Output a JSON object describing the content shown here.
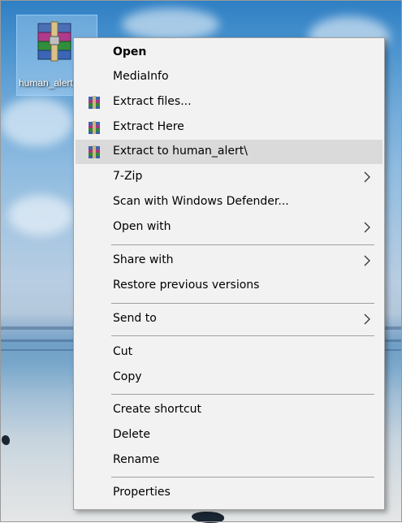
{
  "desktop_icon": {
    "label": "human_alert",
    "icon": "winrar-archive-icon"
  },
  "context_menu": {
    "highlighted_item": "Extract to human_alert\\",
    "items": [
      {
        "label": "Open",
        "bold": true
      },
      {
        "label": "MediaInfo"
      },
      {
        "label": "Extract files...",
        "icon": "winrar-icon"
      },
      {
        "label": "Extract Here",
        "icon": "winrar-icon"
      },
      {
        "label": "Extract to human_alert\\",
        "icon": "winrar-icon"
      },
      {
        "label": "7-Zip",
        "submenu": true
      },
      {
        "label": "Scan with Windows Defender..."
      },
      {
        "label": "Open with",
        "submenu": true
      },
      {
        "label": "Share with",
        "submenu": true
      },
      {
        "label": "Restore previous versions"
      },
      {
        "label": "Send to",
        "submenu": true
      },
      {
        "label": "Cut"
      },
      {
        "label": "Copy"
      },
      {
        "label": "Create shortcut"
      },
      {
        "label": "Delete"
      },
      {
        "label": "Rename"
      },
      {
        "label": "Properties"
      }
    ]
  },
  "colors": {
    "menu_background": "#f2f2f2",
    "highlight": "#dadada",
    "separator": "#a0a0a0"
  }
}
